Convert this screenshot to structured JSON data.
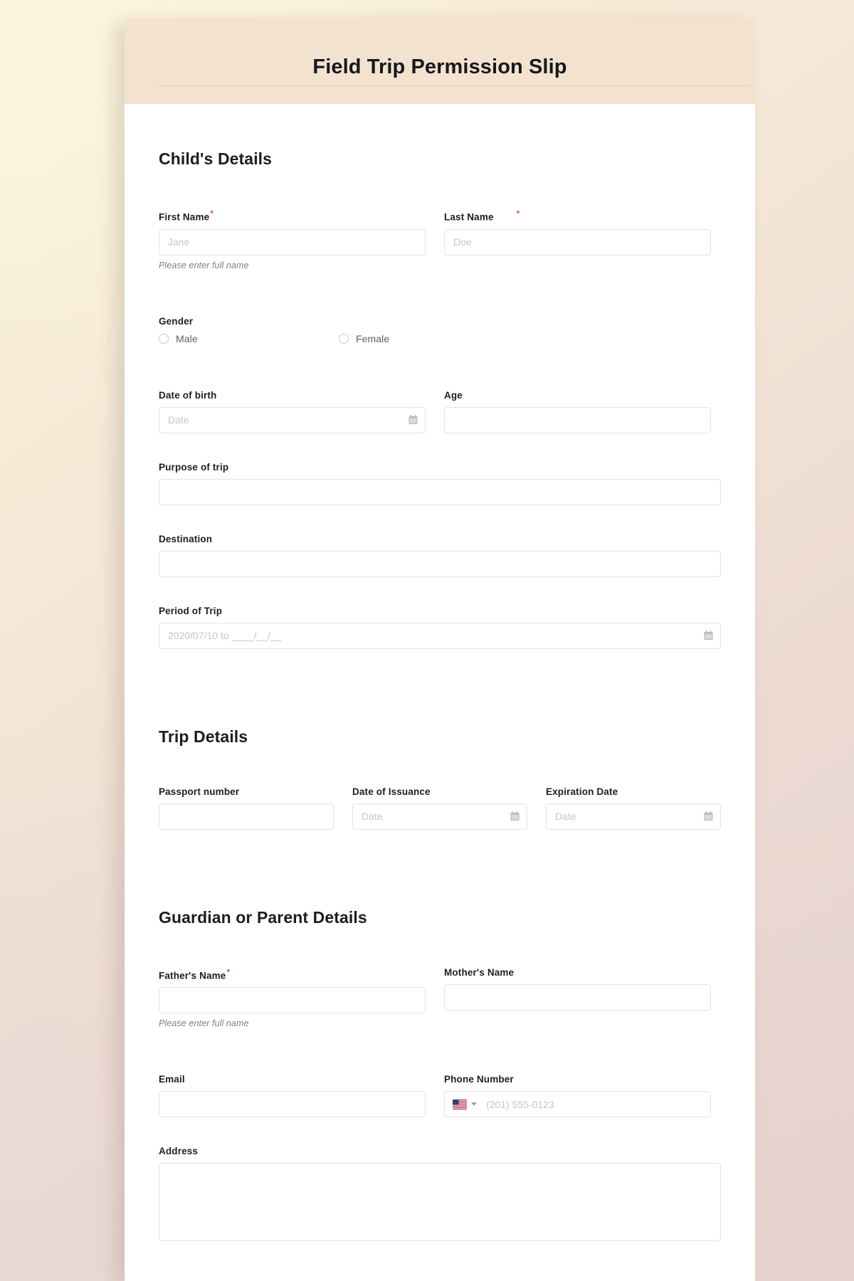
{
  "theme": {
    "header_bg": "#F3E2CE",
    "card_bg": "#FFFFFF",
    "required_color": "#E8543F",
    "border_color": "#E2E4E8",
    "placeholder_color": "#C3C6CC"
  },
  "header": {
    "title": "Field Trip Permission Slip"
  },
  "sections": {
    "child": {
      "title": "Child's Details",
      "first_name": {
        "label": "First Name",
        "required": "*",
        "placeholder": "Jane",
        "value": "",
        "hint": "Please enter full name"
      },
      "last_name": {
        "label": "Last Name",
        "required": "*",
        "placeholder": "Doe",
        "value": ""
      },
      "gender": {
        "label": "Gender",
        "options": [
          {
            "label": "Male",
            "selected": false
          },
          {
            "label": "Female",
            "selected": false
          }
        ]
      },
      "dob": {
        "label": "Date of birth",
        "placeholder": "Date",
        "value": "",
        "icon": "calendar-icon"
      },
      "age": {
        "label": "Age",
        "placeholder": "",
        "value": ""
      },
      "purpose": {
        "label": "Purpose of trip",
        "placeholder": "",
        "value": ""
      },
      "destination": {
        "label": "Destination",
        "placeholder": "",
        "value": ""
      },
      "period": {
        "label": "Period of Trip",
        "placeholder": "2020/07/10 to ____/__/__",
        "value": "",
        "icon": "calendar-icon"
      }
    },
    "trip": {
      "title": "Trip Details",
      "passport": {
        "label": "Passport number",
        "placeholder": "",
        "value": ""
      },
      "issuance": {
        "label": "Date of Issuance",
        "placeholder": "Date",
        "value": "",
        "icon": "calendar-icon"
      },
      "expiration": {
        "label": "Expiration Date",
        "placeholder": "Date",
        "value": "",
        "icon": "calendar-icon"
      }
    },
    "guardian": {
      "title": "Guardian or Parent Details",
      "father": {
        "label": "Father's Name",
        "required": "*",
        "placeholder": "",
        "value": "",
        "hint": "Please enter full name"
      },
      "mother": {
        "label": "Mother's Name",
        "placeholder": "",
        "value": ""
      },
      "email": {
        "label": "Email",
        "placeholder": "",
        "value": ""
      },
      "phone": {
        "label": "Phone Number",
        "placeholder": "(201) 555-0123",
        "value": "",
        "country_flag": "us-flag-icon",
        "caret": "chevron-down-icon"
      },
      "address": {
        "label": "Address",
        "placeholder": "",
        "value": ""
      }
    }
  }
}
